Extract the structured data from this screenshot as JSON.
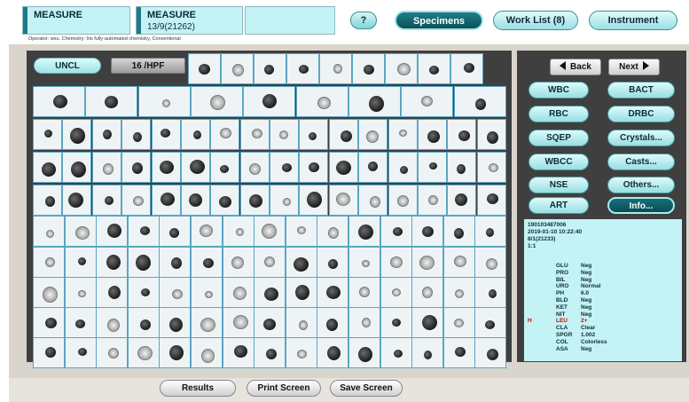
{
  "header": {
    "box1_title": "MEASURE",
    "box2_title": "MEASURE",
    "box2_sub": "13/9(21262)",
    "help_label": "?",
    "operator_text": "Operator: wsu.   Chemistry: Iris fully-automated chemistry, Conventional"
  },
  "tabs": [
    {
      "label": "Specimens",
      "active": true
    },
    {
      "label": "Work List (8)",
      "active": false
    },
    {
      "label": "Instrument",
      "active": false
    }
  ],
  "toolbar": {
    "category_label": "UNCL",
    "count_label": "16 /HPF"
  },
  "nav": {
    "back_label": "Back",
    "next_label": "Next"
  },
  "categories": [
    {
      "label": "WBC",
      "active": false
    },
    {
      "label": "BACT",
      "active": false
    },
    {
      "label": "RBC",
      "active": false
    },
    {
      "label": "DRBC",
      "active": false
    },
    {
      "label": "SQEP",
      "active": false
    },
    {
      "label": "Crystals...",
      "active": false
    },
    {
      "label": "WBCC",
      "active": false
    },
    {
      "label": "Casts...",
      "active": false
    },
    {
      "label": "NSE",
      "active": false
    },
    {
      "label": "Others...",
      "active": false
    },
    {
      "label": "ART",
      "active": false
    },
    {
      "label": "Info...",
      "active": true
    }
  ],
  "specimen_info": {
    "id": "190103487006",
    "datetime": "2019-01-10 10:22:40",
    "rack": "8/1(21233)",
    "dilution": "1:1"
  },
  "chemistry": [
    {
      "flag": "",
      "key": "GLU",
      "value": "Neg"
    },
    {
      "flag": "",
      "key": "PRO",
      "value": "Neg"
    },
    {
      "flag": "",
      "key": "BIL",
      "value": "Neg"
    },
    {
      "flag": "",
      "key": "URO",
      "value": "Normal"
    },
    {
      "flag": "",
      "key": "PH",
      "value": "6.0"
    },
    {
      "flag": "",
      "key": "BLD",
      "value": "Neg"
    },
    {
      "flag": "",
      "key": "KET",
      "value": "Neg"
    },
    {
      "flag": "",
      "key": "NIT",
      "value": "Neg"
    },
    {
      "flag": "H",
      "key": "LEU",
      "value": "2+"
    },
    {
      "flag": "",
      "key": "CLA",
      "value": "Clear"
    },
    {
      "flag": "",
      "key": "SPGR",
      "value": "1.002"
    },
    {
      "flag": "",
      "key": "COL",
      "value": "Colorless"
    },
    {
      "flag": "",
      "key": "ASA",
      "value": "Neg"
    }
  ],
  "bottom": {
    "results_label": "Results",
    "print_label": "Print Screen",
    "save_label": "Save Screen"
  },
  "cell_grid": {
    "row_counts": [
      9,
      16,
      16,
      16,
      15,
      15,
      15,
      15,
      15,
      15
    ],
    "colors": {
      "cell_border": "#5aa6c4",
      "highlight": "#d40000",
      "accent": "#1d7a86"
    }
  }
}
